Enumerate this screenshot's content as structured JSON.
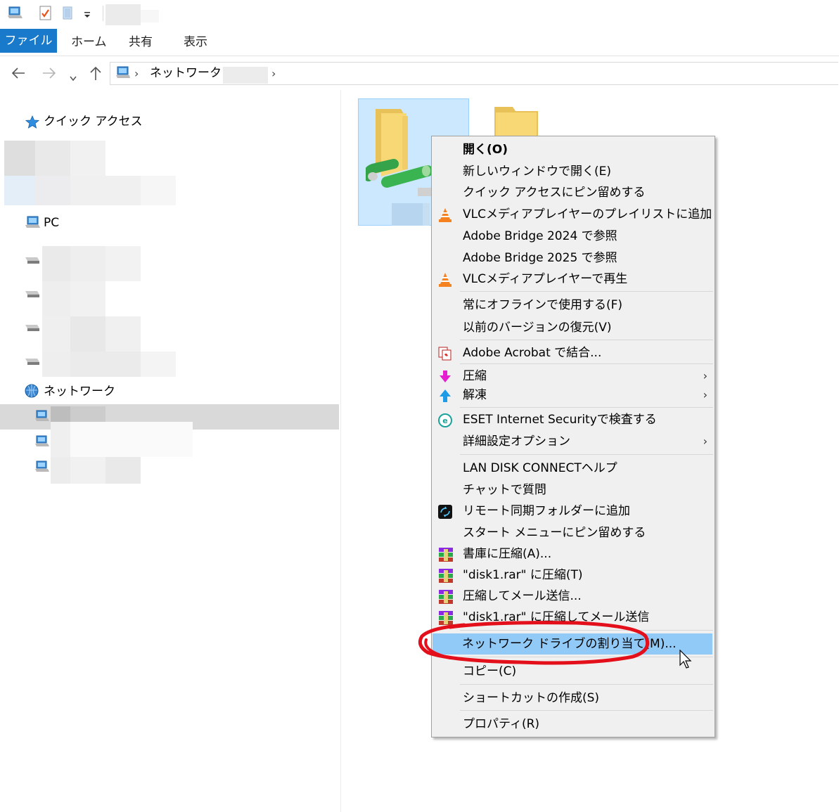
{
  "quick_access_toolbar": {
    "icons": [
      "computer-icon",
      "properties-check-icon",
      "new-folder-icon",
      "customize-dropdown-icon"
    ]
  },
  "ribbon": {
    "tabs": [
      {
        "label": "ファイル",
        "active": true
      },
      {
        "label": "ホーム"
      },
      {
        "label": "共有"
      },
      {
        "label": "表示"
      }
    ],
    "accent": "#1979ca"
  },
  "address_bar": {
    "breadcrumb": [
      "ネットワーク"
    ]
  },
  "navigation_pane": {
    "quick_access": "クイック アクセス",
    "pc": "PC",
    "network": "ネットワーク"
  },
  "context_menu": {
    "highlight_color": "#91c9f7",
    "items": [
      {
        "label": "開く(O)",
        "bold": true
      },
      {
        "label": "新しいウィンドウで開く(E)"
      },
      {
        "label": "クイック アクセスにピン留めする"
      },
      {
        "label": "VLCメディアプレイヤーのプレイリストに追加",
        "icon": "vlc-cone-icon"
      },
      {
        "label": "Adobe Bridge 2024 で参照"
      },
      {
        "label": "Adobe Bridge 2025 で参照"
      },
      {
        "label": "VLCメディアプレイヤーで再生",
        "icon": "vlc-cone-icon"
      },
      {
        "label": "常にオフラインで使用する(F)"
      },
      {
        "label": "以前のバージョンの復元(V)"
      },
      {
        "label": "Adobe Acrobat で結合...",
        "icon": "acrobat-combine-icon"
      },
      {
        "label": "圧縮",
        "icon": "compress-arrow-icon",
        "submenu": true
      },
      {
        "label": "解凍",
        "icon": "extract-arrow-icon",
        "submenu": true
      },
      {
        "label": "ESET Internet Securityで検査する",
        "icon": "eset-icon"
      },
      {
        "label": "詳細設定オプション",
        "submenu": true
      },
      {
        "label": "LAN DISK CONNECTヘルプ"
      },
      {
        "label": "チャットで質問"
      },
      {
        "label": "リモート同期フォルダーに追加",
        "icon": "remote-sync-icon"
      },
      {
        "label": "スタート メニューにピン留めする"
      },
      {
        "label": "書庫に圧縮(A)...",
        "icon": "winrar-icon"
      },
      {
        "label": "\"disk1.rar\" に圧縮(T)",
        "icon": "winrar-icon"
      },
      {
        "label": "圧縮してメール送信...",
        "icon": "winrar-icon"
      },
      {
        "label": "\"disk1.rar\" に圧縮してメール送信",
        "icon": "winrar-icon"
      },
      {
        "label": "ネットワーク ドライブの割り当て(M)...",
        "highlighted": true
      },
      {
        "label": "コピー(C)"
      },
      {
        "label": "ショートカットの作成(S)"
      },
      {
        "label": "プロパティ(R)"
      }
    ]
  },
  "annotation": {
    "color": "#e3101b"
  }
}
